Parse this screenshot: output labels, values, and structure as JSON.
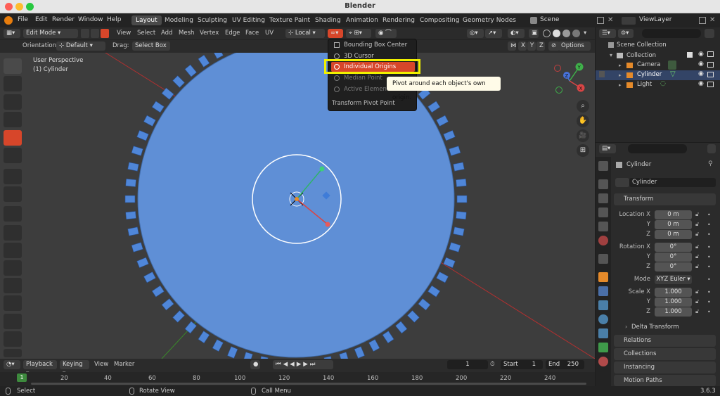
{
  "window": {
    "title": "Blender"
  },
  "menu": [
    "File",
    "Edit",
    "Render",
    "Window",
    "Help"
  ],
  "workspaces": [
    "Layout",
    "Modeling",
    "Sculpting",
    "UV Editing",
    "Texture Paint",
    "Shading",
    "Animation",
    "Rendering",
    "Compositing",
    "Geometry Nodes"
  ],
  "scene": {
    "name": "Scene",
    "view_layer": "ViewLayer"
  },
  "header": {
    "mode": "Edit Mode",
    "menus": [
      "View",
      "Select",
      "Add",
      "Mesh",
      "Vertex",
      "Edge",
      "Face",
      "UV"
    ],
    "transform_orientation": "Local"
  },
  "tool_options": {
    "orientation_label": "Orientation:",
    "orientation_value": "Default",
    "drag_label": "Drag:",
    "drag_value": "Select Box",
    "axes": [
      "X",
      "Y",
      "Z"
    ],
    "options_label": "Options"
  },
  "viewport": {
    "view_name": "User Perspective",
    "object_name": "(1) Cylinder"
  },
  "pivot_menu": {
    "items": [
      "Bounding Box Center",
      "3D Cursor",
      "Individual Origins",
      "Median Point",
      "Active Element"
    ],
    "selected": "Individual Origins",
    "title": "Transform Pivot Point"
  },
  "tooltip": {
    "text": "Pivot around each object's own origin."
  },
  "outliner": {
    "collection_root": "Scene Collection",
    "collection": "Collection",
    "objects": [
      "Camera",
      "Cylinder",
      "Light"
    ]
  },
  "properties": {
    "object_name": "Cylinder",
    "data_name": "Cylinder",
    "transform_header": "Transform",
    "location_label": "Location X",
    "location": [
      "0 m",
      "0 m",
      "0 m"
    ],
    "rotation_label": "Rotation X",
    "rotation": [
      "0°",
      "0°",
      "0°"
    ],
    "y_label": "Y",
    "z_label": "Z",
    "mode_label": "Mode",
    "mode_value": "XYZ Euler",
    "scale_label": "Scale X",
    "scale": [
      "1.000",
      "1.000",
      "1.000"
    ],
    "delta_transform": "Delta Transform",
    "panels": [
      "Relations",
      "Collections",
      "Instancing",
      "Motion Paths"
    ]
  },
  "timeline": {
    "menus": [
      "Playback",
      "Keying",
      "View",
      "Marker"
    ],
    "current_frame": "1",
    "start_label": "Start",
    "start": "1",
    "end_label": "End",
    "end": "250",
    "ticks": [
      "1",
      "20",
      "40",
      "60",
      "80",
      "100",
      "120",
      "140",
      "160",
      "180",
      "200",
      "220",
      "240"
    ]
  },
  "status": {
    "select": "Select",
    "rotate": "Rotate View",
    "call_menu": "Call Menu",
    "version": "3.6.3"
  },
  "colors": {
    "accent": "#d7462a",
    "highlight": "#f0f000",
    "mesh": "#5f8fd6"
  }
}
